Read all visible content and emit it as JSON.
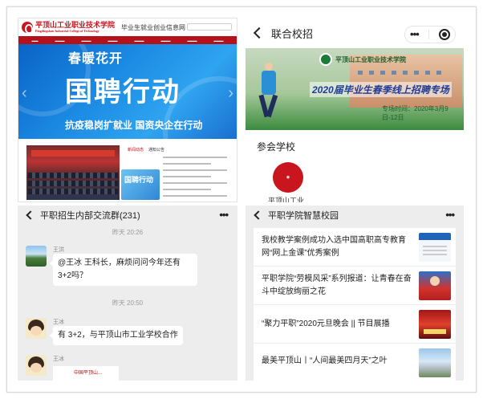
{
  "website": {
    "logo_text": "平顶山工业职业技术学院",
    "logo_text_en": "Pingdingshan Industrial College of Technology",
    "subtitle": "毕业生就业创业信息网",
    "banner_line1": "春暖花开",
    "banner_line2": "国聘行动",
    "banner_line3": "抗疫稳岗扩就业 国资央企在行动",
    "photo_thumb_text": "国聘行动",
    "news_tab1": "新闻动态",
    "news_tab2": "通知公告"
  },
  "mini_program": {
    "title": "联合校招",
    "banner_school": "平顶山工业职业技术学院",
    "banner_headline": "2020届毕业生春季线上招聘专场",
    "banner_date": "专场时间：2020年3月9日-12日",
    "section_title": "参会学校",
    "school_label": "平顶山工业..."
  },
  "group_chat": {
    "title": "平职招生内部交流群(231)",
    "messages": [
      {
        "time": "昨天 20:26",
        "sender": "王洪",
        "text": "@王冰  王科长，麻烦问问今年还有3+2吗？"
      },
      {
        "time": "昨天 20:50",
        "sender": "王冰",
        "text": "有 3+2，与平顶山市工业学校合作"
      },
      {
        "sender": "王冰",
        "image_caption": "中国平顶山..."
      }
    ]
  },
  "campus_feed": {
    "title": "平职学院智慧校园",
    "articles": [
      {
        "text": "我校教学案例成功入选中国高职高专教育网“网上金课”优秀案例",
        "thumb": "document-thumbnail"
      },
      {
        "text": "平职学院“劳模风采”系列报道：让青春在奋斗中绽放绚丽之花",
        "thumb": "portrait-thumbnail"
      },
      {
        "text": "“聚力平职”2020元旦晚会 || 节目展播",
        "thumb": "stage-thumbnail"
      },
      {
        "text": "最美平顶山丨“人间最美四月天”之叶",
        "thumb": "campus-thumbnail"
      }
    ]
  }
}
